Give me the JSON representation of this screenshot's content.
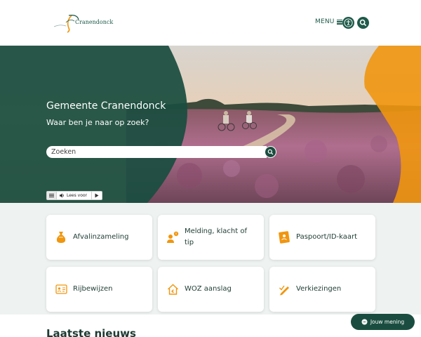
{
  "header": {
    "logo_text": "Cranendonck",
    "menu_label": "MENU"
  },
  "hero": {
    "title": "Gemeente Cranendonck",
    "subtitle": "Waar ben je naar op zoek?",
    "search": {
      "placeholder": "Zoeken"
    },
    "readspeaker": {
      "listen_label": "Lees voor"
    }
  },
  "tiles": [
    {
      "label": "Afvalinzameling",
      "icon": "waste-bag-icon"
    },
    {
      "label": "Melding, klacht of tip",
      "icon": "report-person-icon"
    },
    {
      "label": "Paspoort/ID-kaart",
      "icon": "passport-icon"
    },
    {
      "label": "Rijbewijzen",
      "icon": "drivers-license-icon"
    },
    {
      "label": "WOZ aanslag",
      "icon": "house-euro-icon"
    },
    {
      "label": "Verkiezingen",
      "icon": "vote-pencil-icon"
    }
  ],
  "news": {
    "title": "Laatste nieuws"
  },
  "feedback": {
    "label": "Jouw mening"
  },
  "colors": {
    "brand_green": "#1e5a49",
    "accent_orange": "#f0960f",
    "tiles_bg": "#eef3f1"
  }
}
